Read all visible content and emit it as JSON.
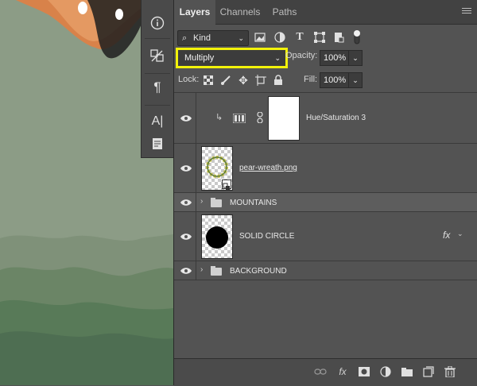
{
  "tabs": [
    {
      "label": "Layers",
      "active": true
    },
    {
      "label": "Channels",
      "active": false
    },
    {
      "label": "Paths",
      "active": false
    }
  ],
  "filter": {
    "kind_label": "Kind",
    "icons": [
      "image-filter-icon",
      "adjustment-filter-icon",
      "type-filter-icon",
      "shape-filter-icon",
      "smart-object-filter-icon",
      "filter-toggle-icon"
    ]
  },
  "blend": {
    "mode": "Multiply",
    "highlight_color": "#f2f20a",
    "opacity_label": "Opacity:",
    "opacity_value": "100%"
  },
  "lock": {
    "label": "Lock:",
    "icons": [
      "lock-transparent-icon",
      "lock-image-icon",
      "lock-position-icon",
      "lock-artboard-icon",
      "lock-all-icon"
    ],
    "fill_label": "Fill:",
    "fill_value": "100%"
  },
  "layers": [
    {
      "name": "Hue/Saturation 3",
      "type": "adjustment",
      "visible": true,
      "clipped": true
    },
    {
      "name": "pear-wreath.png",
      "type": "smart-object",
      "visible": true
    },
    {
      "name": "MOUNTAINS",
      "type": "group",
      "visible": true,
      "selected": true
    },
    {
      "name": "SOLID CIRCLE",
      "type": "layer",
      "visible": true,
      "fx": "fx"
    },
    {
      "name": "BACKGROUND",
      "type": "group",
      "visible": true
    }
  ],
  "bottom_icons": [
    "link-layers-icon",
    "add-style-icon",
    "add-mask-icon",
    "adjustment-layer-icon",
    "new-group-icon",
    "new-layer-icon",
    "delete-layer-icon"
  ],
  "bottom_fx_label": "fx",
  "colors": {
    "panel_bg": "#535353",
    "selected_row": "#5d5d5d",
    "canvas_green": "#8b9b85"
  }
}
